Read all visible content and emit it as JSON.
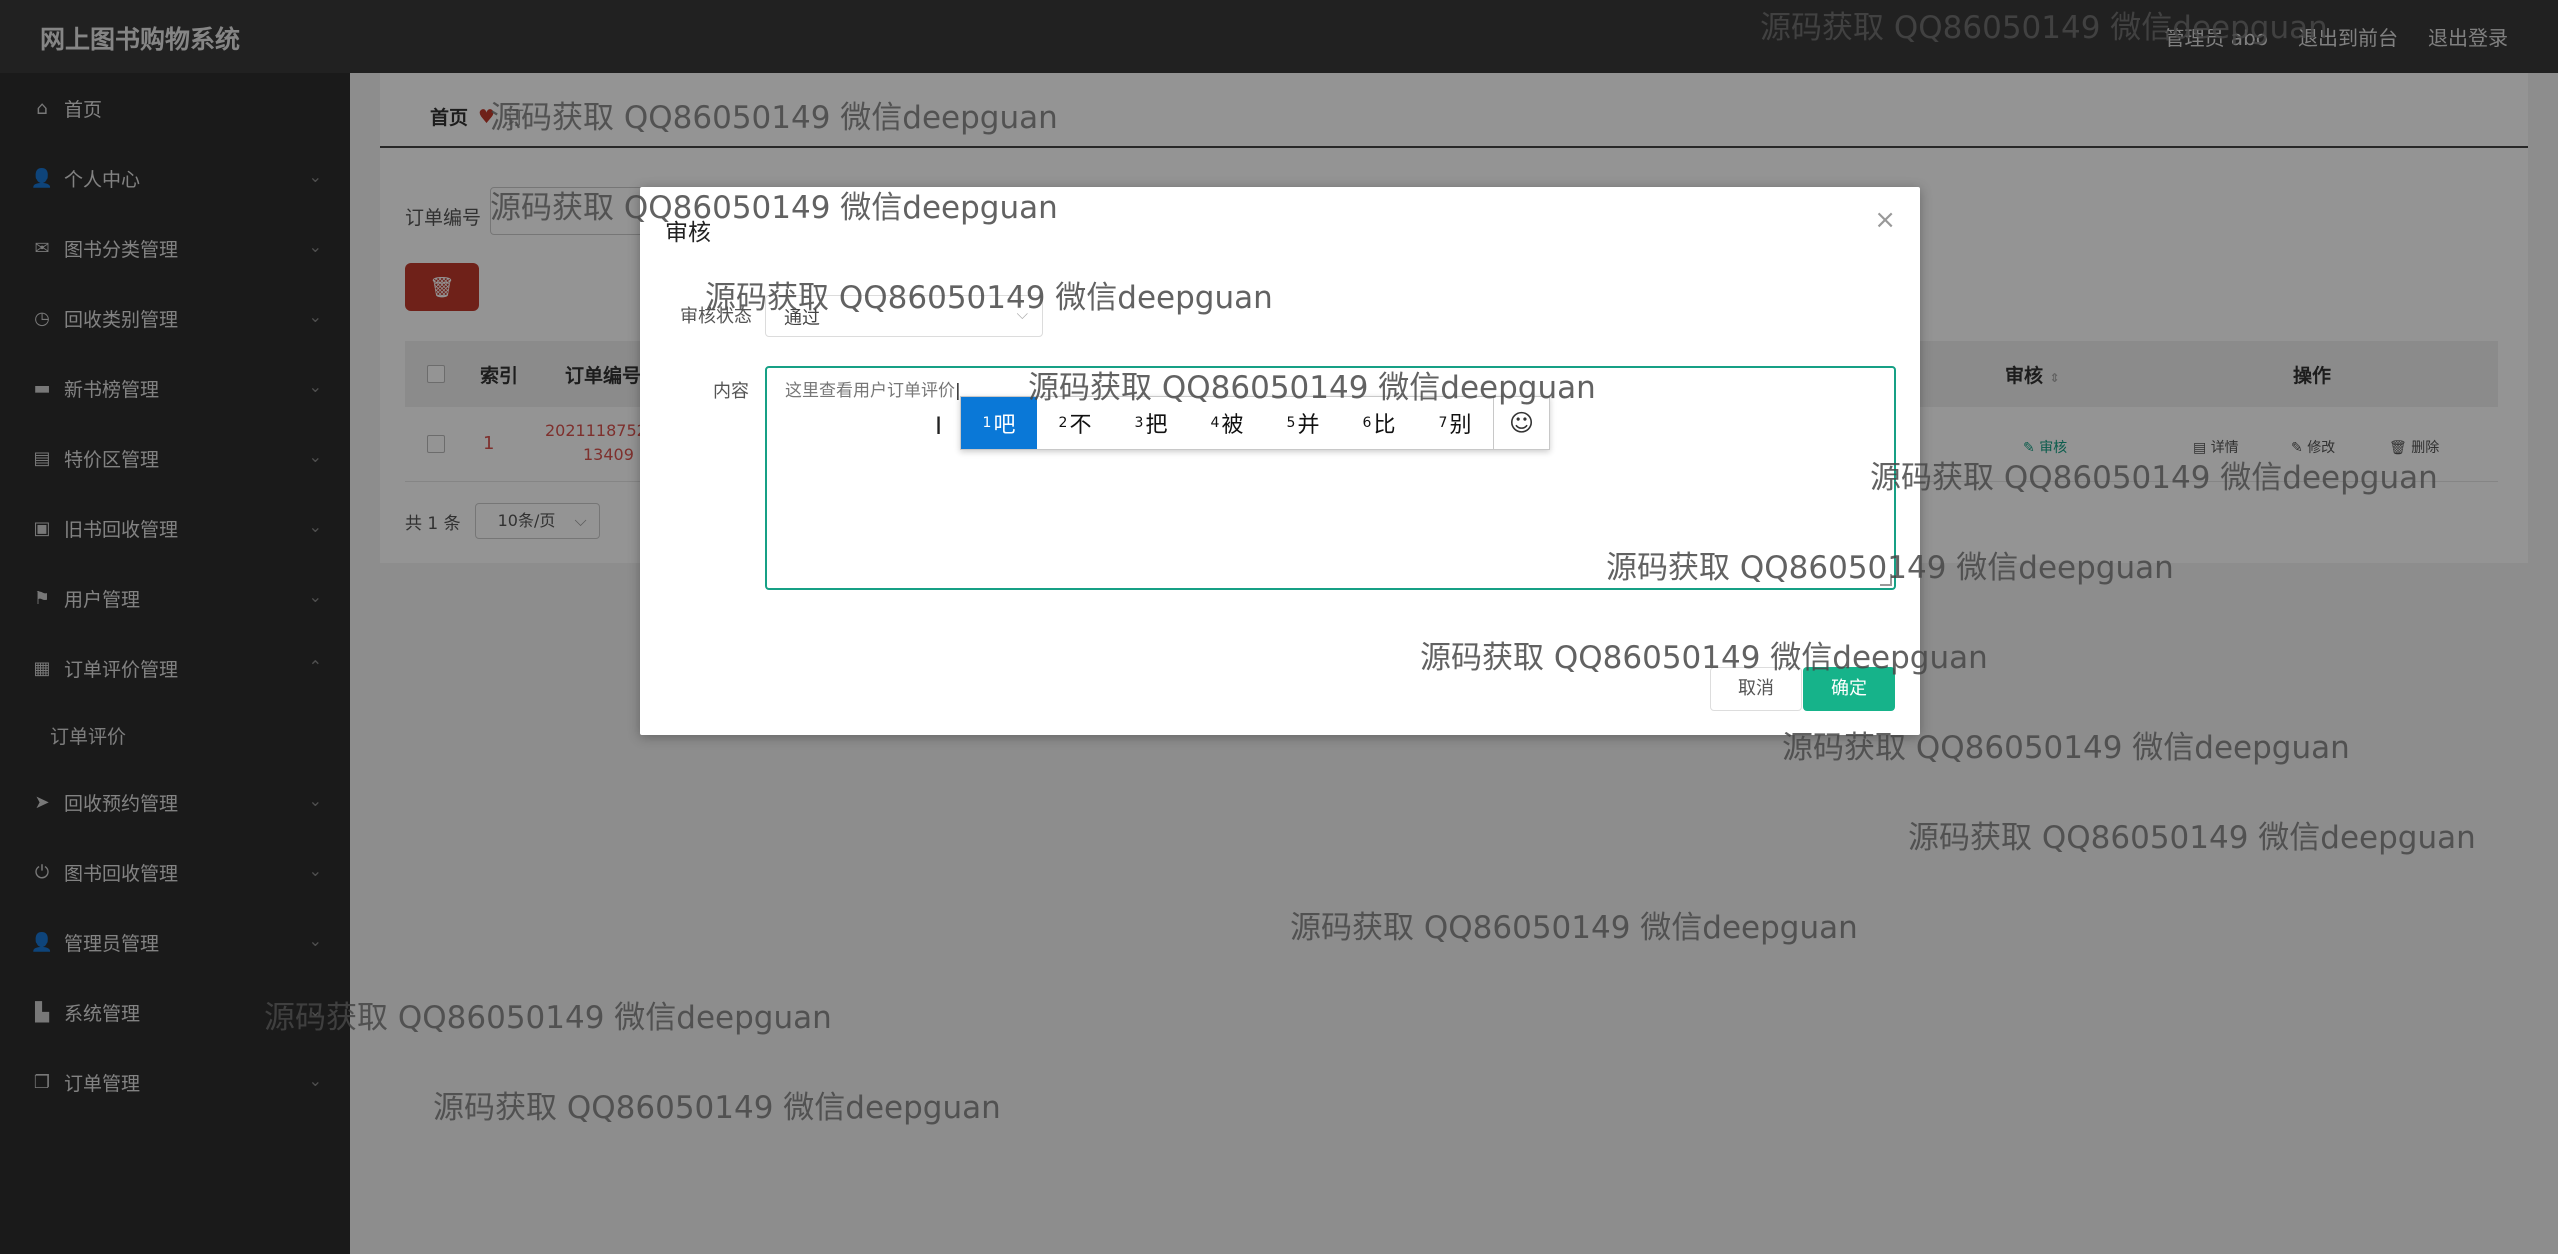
{
  "app": {
    "title": "网上图书购物系统",
    "top_links": [
      "管理员 abo",
      "退出到前台",
      "退出登录"
    ]
  },
  "sidebar": {
    "items": [
      {
        "label": "首页",
        "icon": "home-icon",
        "glyph": "⌂"
      },
      {
        "label": "个人中心",
        "icon": "user-icon",
        "glyph": "👤"
      },
      {
        "label": "图书分类管理",
        "icon": "mail-icon",
        "glyph": "✉"
      },
      {
        "label": "回收类别管理",
        "icon": "compass-icon",
        "glyph": "◷"
      },
      {
        "label": "新书榜管理",
        "icon": "car-icon",
        "glyph": "▬"
      },
      {
        "label": "特价区管理",
        "icon": "clipboard-icon",
        "glyph": "▤"
      },
      {
        "label": "旧书回收管理",
        "icon": "clipboard-check-icon",
        "glyph": "▣"
      },
      {
        "label": "用户管理",
        "icon": "flag-icon",
        "glyph": "⚑"
      },
      {
        "label": "订单评价管理",
        "icon": "clipboard-x-icon",
        "glyph": "▦"
      },
      {
        "label": "回收预约管理",
        "icon": "send-icon",
        "glyph": "➤"
      },
      {
        "label": "图书回收管理",
        "icon": "power-icon",
        "glyph": "⏻"
      },
      {
        "label": "管理员管理",
        "icon": "admin-icon",
        "glyph": "👤"
      },
      {
        "label": "系统管理",
        "icon": "briefcase-icon",
        "glyph": "▙"
      },
      {
        "label": "订单管理",
        "icon": "copy-icon",
        "glyph": "❐"
      }
    ],
    "sub_item": "订单评价"
  },
  "main": {
    "breadcrumb_home": "首页",
    "breadcrumb_current": "订",
    "search_label": "订单编号",
    "table": {
      "headers": [
        "索引",
        "订单编号",
        "审核",
        "操作"
      ],
      "row": {
        "index": "1",
        "order_no_line1": "2021118752",
        "order_no_line2": "13409",
        "audit": "审核",
        "actions": [
          "详情",
          "修改",
          "删除"
        ]
      }
    },
    "pagination": {
      "total": "共 1 条",
      "page_size": "10条/页"
    }
  },
  "dialog": {
    "title": "审核",
    "status_label": "审核状态",
    "status_value": "通过",
    "content_label": "内容",
    "content_value": "这里查看用户订单评价",
    "cancel": "取消",
    "confirm": "确定"
  },
  "ime": {
    "candidates": [
      {
        "n": "1",
        "w": "吧"
      },
      {
        "n": "2",
        "w": "不"
      },
      {
        "n": "3",
        "w": "把"
      },
      {
        "n": "4",
        "w": "被"
      },
      {
        "n": "5",
        "w": "并"
      },
      {
        "n": "6",
        "w": "比"
      },
      {
        "n": "7",
        "w": "别"
      }
    ],
    "emoji": "☺"
  },
  "watermark": "源码获取 QQ86050149 微信deepguan",
  "colors": {
    "accent": "#16b38a",
    "danger": "#c0392b",
    "ime_select": "#0a78d7"
  }
}
